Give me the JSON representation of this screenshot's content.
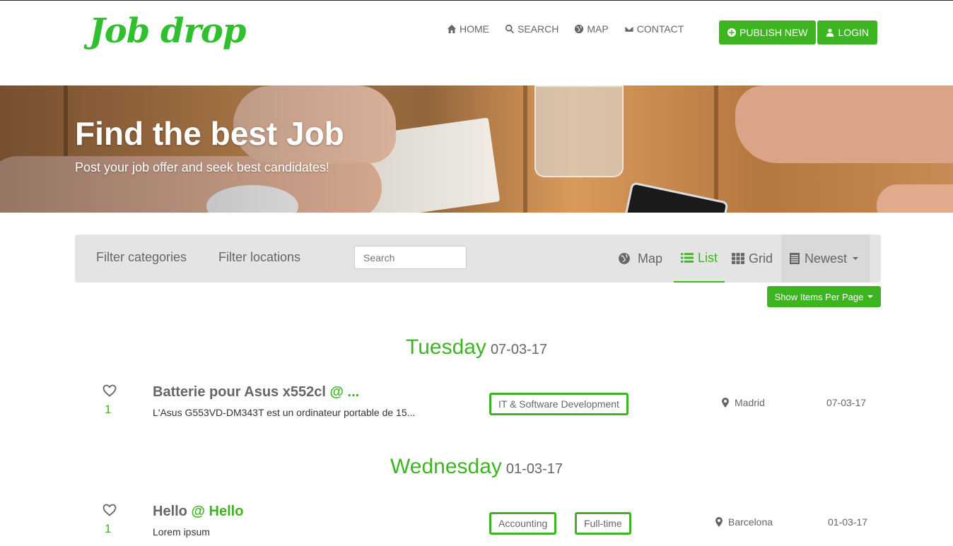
{
  "brand": {
    "logo_text": "Job drop",
    "accent": "#3cb521"
  },
  "nav": [
    {
      "label": "HOME",
      "icon": "home-icon"
    },
    {
      "label": "SEARCH",
      "icon": "search-icon"
    },
    {
      "label": "MAP",
      "icon": "globe-icon"
    },
    {
      "label": "CONTACT",
      "icon": "envelope-icon"
    }
  ],
  "header_buttons": {
    "publish_label": "PUBLISH NEW",
    "login_label": "LOGIN"
  },
  "hero": {
    "title": "Find the best Job",
    "subtitle": "Post your job offer and seek best candidates!"
  },
  "filters": {
    "categories_label": "Filter categories",
    "locations_label": "Filter locations",
    "search_placeholder": "Search",
    "views": [
      {
        "label": "Map",
        "icon": "globe-icon",
        "active": false
      },
      {
        "label": "List",
        "icon": "list-icon",
        "active": true
      },
      {
        "label": "Grid",
        "icon": "grid-icon",
        "active": false
      }
    ],
    "sort_label": "Newest",
    "per_page_label": "Show Items Per Page"
  },
  "days": [
    {
      "day_name": "Tuesday",
      "date": "07-03-17",
      "listings": [
        {
          "title": "Batterie pour Asus x552cl",
          "company": "@ ...",
          "description": "L'Asus G553VD-DM343T est un ordinateur portable de 15...",
          "likes": "1",
          "tags": [
            "IT & Software Development"
          ],
          "location": "Madrid",
          "date": "07-03-17"
        }
      ]
    },
    {
      "day_name": "Wednesday",
      "date": "01-03-17",
      "listings": [
        {
          "title": "Hello",
          "company": "@ Hello",
          "description": "Lorem ipsum",
          "likes": "1",
          "tags": [
            "Accounting",
            "Full-time"
          ],
          "location": "Barcelona",
          "date": "01-03-17"
        }
      ]
    }
  ]
}
